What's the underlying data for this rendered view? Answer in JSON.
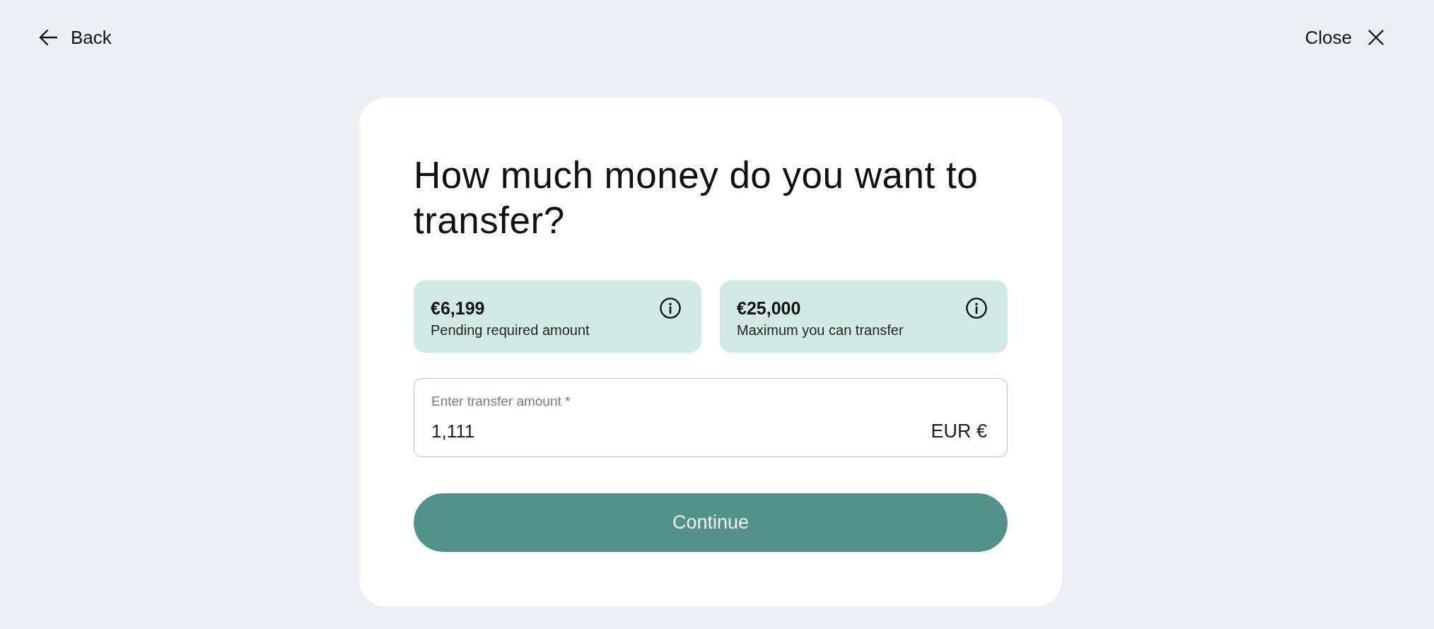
{
  "top_bar": {
    "back": {
      "label": "Back"
    },
    "close": {
      "label": "Close"
    }
  },
  "card": {
    "title": "How much money do you want to transfer?",
    "info_boxes": [
      {
        "amount": "€6,199",
        "label": "Pending required amount"
      },
      {
        "amount": "€25,000",
        "label": "Maximum you can transfer"
      }
    ],
    "amount_field": {
      "label": "Enter transfer amount *",
      "value": "1,111",
      "currency": "EUR €"
    },
    "continue_button": {
      "label": "Continue"
    }
  }
}
